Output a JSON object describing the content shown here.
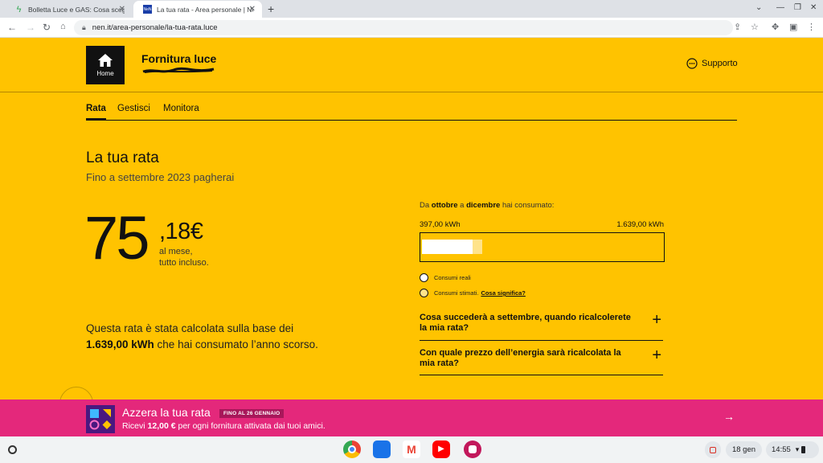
{
  "browser": {
    "tabs": [
      {
        "title": "Bolletta Luce e GAS: Cosa scegl..."
      },
      {
        "title": "La tua rata - Area personale | Ne..."
      }
    ],
    "tab2_favicon": "NeN",
    "url": "nen.it/area-personale/la-tua-rata.luce"
  },
  "header": {
    "home_label": "Home",
    "title": "Fornitura luce",
    "support_label": "Supporto"
  },
  "subnav": {
    "tabs": [
      "Rata",
      "Gestisci",
      "Monitora"
    ]
  },
  "main": {
    "title": "La tua rata",
    "subtitle": "Fino a settembre 2023 pagherai",
    "amount_int": "75",
    "amount_dec": ",18€",
    "per_month": "al mese,",
    "included": "tutto incluso.",
    "para_pre": "Questa rata è stata calcolata sulla base dei ",
    "para_kwh": "1.639,00 kWh",
    "para_post": " che hai consumato l’anno scorso."
  },
  "consumption": {
    "pre": "Da ",
    "from": "ottobre",
    "mid": " a ",
    "to": "dicembre",
    "post": " hai consumato:",
    "real_value": "397,00 kWh",
    "total_value": "1.639,00 kWh",
    "real_fraction": 0.21,
    "estimated_fraction": 0.04,
    "legend_real": "Consumi reali",
    "legend_est": "Consumi stimati.",
    "legend_link": "Cosa significa?"
  },
  "faq": [
    "Cosa succederà a settembre, quando ricalcolerete la mia rata?",
    "Con quale prezzo dell’energia sarà ricalcolata la mia rata?"
  ],
  "promo": {
    "title": "Azzera la tua rata",
    "badge": "FINO AL 26 GENNAIO",
    "text_pre": "Ricevi ",
    "text_amount": "12,00 €",
    "text_post": " per ogni fornitura attivata dai tuoi amici."
  },
  "shelf": {
    "date": "18 gen",
    "time": "14:55"
  },
  "colors": {
    "brand_yellow": "#ffc300",
    "promo_pink": "#e4287b"
  }
}
